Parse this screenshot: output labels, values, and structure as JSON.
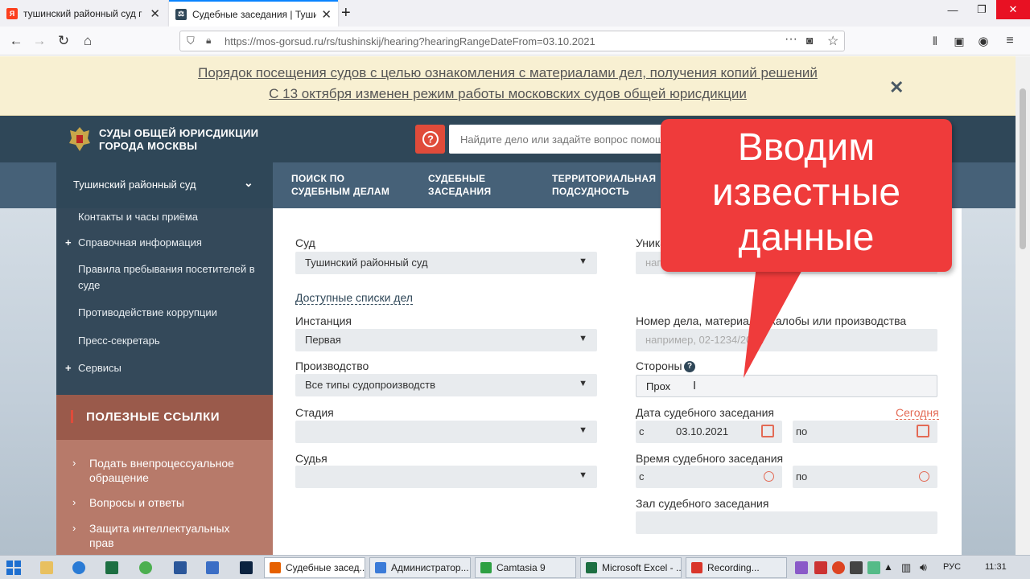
{
  "browser": {
    "tabs": [
      {
        "title": "тушинский районный суд г м",
        "active": false,
        "favicon": "yandex-icon"
      },
      {
        "title": "Судебные заседания | Тушинс",
        "active": true,
        "favicon": "site-icon"
      }
    ],
    "new_tab": "+",
    "url": "https://mos-gorsud.ru/rs/tushinskij/hearing?hearingRangeDateFrom=03.10.2021"
  },
  "notice": {
    "link1": "Порядок посещения судов с целью ознакомления с материалами дел, получения копий решений",
    "link2": "С 13 октября изменен режим работы московских судов общей юрисдикции",
    "close": "✕"
  },
  "header": {
    "logo_line1": "СУДЫ ОБЩЕЙ ЮРИСДИКЦИИ",
    "logo_line2": "ГОРОДА МОСКВЫ",
    "help": "?",
    "search_placeholder": "Найдите дело или задайте вопрос помощнику"
  },
  "nav": {
    "court": "Тушинский районный суд",
    "items": [
      {
        "line1": "ПОИСК ПО",
        "line2": "СУДЕБНЫМ ДЕЛАМ"
      },
      {
        "line1": "СУДЕБНЫЕ",
        "line2": "ЗАСЕДАНИЯ"
      },
      {
        "line1": "ТЕРРИТОРИАЛЬНАЯ",
        "line2": "ПОДСУДНОСТЬ"
      }
    ]
  },
  "sidebar": {
    "items": [
      {
        "label": "Контакты и часы приёма",
        "plus": false
      },
      {
        "label": "Справочная информация",
        "plus": true
      },
      {
        "label": "Правила пребывания посетителей в суде",
        "plus": false
      },
      {
        "label": "Противодействие коррупции",
        "plus": false
      },
      {
        "label": "Пресс-секретарь",
        "plus": false
      },
      {
        "label": "Сервисы",
        "plus": true
      }
    ],
    "useful_title": "ПОЛЕЗНЫЕ ССЫЛКИ",
    "useful_links": [
      "Подать внепроцессуальное обращение",
      "Вопросы и ответы",
      "Защита интеллектуальных прав"
    ]
  },
  "form": {
    "court_label": "Суд",
    "court_value": "Тушинский районный суд",
    "lists_link": "Доступные списки дел",
    "instance_label": "Инстанция",
    "instance_value": "Первая",
    "proceeding_label": "Производство",
    "proceeding_value": "Все типы судопроизводств",
    "stage_label": "Стадия",
    "judge_label": "Судья",
    "unique_label": "Уника",
    "unique_placeholder": "напри",
    "case_label": "Номер дела, материала, жалобы или производства",
    "case_placeholder": "например, 02-1234/2021",
    "parties_label": "Стороны",
    "parties_help": "?",
    "parties_value": "Прох",
    "date_label": "Дата судебного заседания",
    "today_link": "Сегодня",
    "date_from_prefix": "с",
    "date_from_value": "03.10.2021",
    "date_to_prefix": "по",
    "time_label": "Время судебного заседания",
    "time_from_prefix": "с",
    "time_to_prefix": "по",
    "hall_label": "Зал судебного заседания"
  },
  "callout": {
    "line1": "Вводим",
    "line2": "известные",
    "line3": "данные"
  },
  "taskbar": {
    "buttons": [
      {
        "label": "Судебные засед...",
        "color": "#e66000"
      },
      {
        "label": "Администратор...",
        "color": "#3b7bd8"
      },
      {
        "label": "Camtasia 9",
        "color": "#2ea043"
      },
      {
        "label": "Microsoft Excel - ...",
        "color": "#1d6f42"
      },
      {
        "label": "Recording...",
        "color": "#d9362b"
      }
    ],
    "lang": "РУС",
    "time": "11:31"
  }
}
